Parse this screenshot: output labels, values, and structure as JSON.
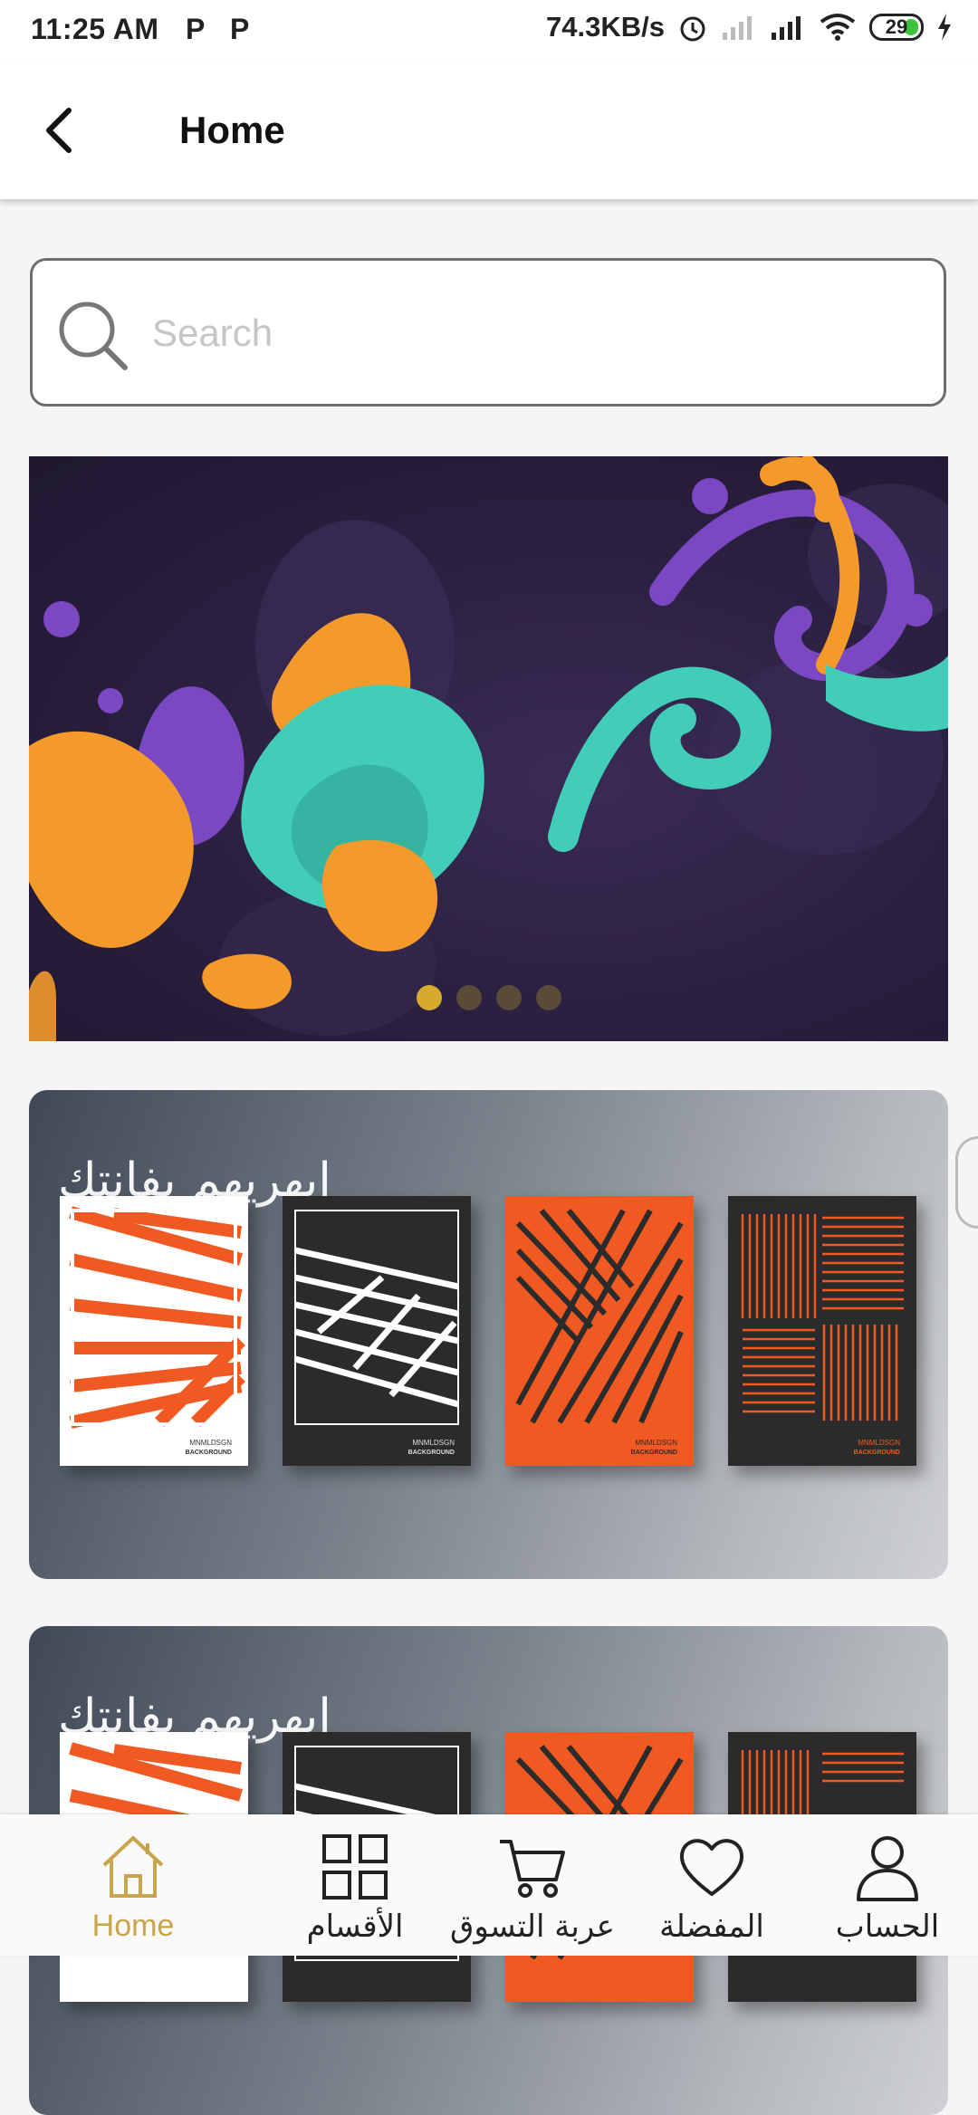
{
  "status_bar": {
    "time": "11:25 AM",
    "speed": "74.3KB/s",
    "battery": "29"
  },
  "app_bar": {
    "title": "Home"
  },
  "search": {
    "placeholder": "Search"
  },
  "carousel": {
    "dot_count": 4,
    "active_index": 0
  },
  "promos": [
    {
      "title": "ابهريهم بفانتك",
      "poster_caption_line1": "MNMLDSGN",
      "poster_caption_line2": "BACKGROUND"
    },
    {
      "title": "ابهريهم بفانتك"
    }
  ],
  "bottom_nav": {
    "items": [
      {
        "label": "Home",
        "icon": "home-icon",
        "active": true
      },
      {
        "label": "الأقسام",
        "icon": "grid-icon"
      },
      {
        "label": "عربة التسوق",
        "icon": "cart-icon"
      },
      {
        "label": "المفضلة",
        "icon": "heart-icon"
      },
      {
        "label": "الحساب",
        "icon": "user-icon"
      }
    ]
  },
  "colors": {
    "accent": "#c9a44a",
    "dot_active": "#d6aa2c",
    "poster_orange": "#f05a22"
  }
}
